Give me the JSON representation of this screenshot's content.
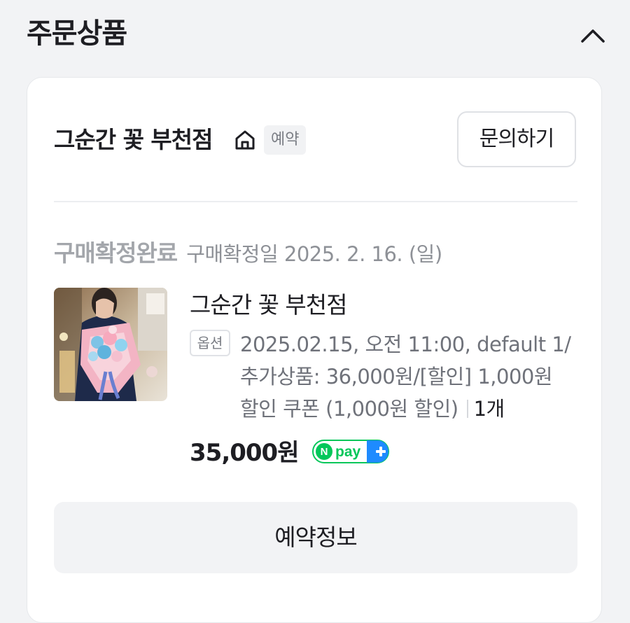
{
  "section": {
    "title": "주문상품"
  },
  "store": {
    "name": "그순간 꽃 부천점",
    "badge": "예약",
    "inquiry_label": "문의하기"
  },
  "order": {
    "status": "구매확정완료",
    "confirm_date": "구매확정일 2025. 2. 16. (일)"
  },
  "product": {
    "name": "그순간 꽃 부천점",
    "option_badge": "옵션",
    "option_lines": [
      "2025.02.15, 오전 11:00, default 1/",
      "추가상품: 36,000원/[할인] 1,000원",
      "할인 쿠폰 (1,000원 할인)"
    ],
    "quantity": "1개",
    "price": "35,000원",
    "pay_badge": "pay"
  },
  "actions": {
    "reservation_info_label": "예약정보"
  },
  "colors": {
    "npay_green": "#03c75a",
    "npay_blue": "#1e8bff"
  }
}
